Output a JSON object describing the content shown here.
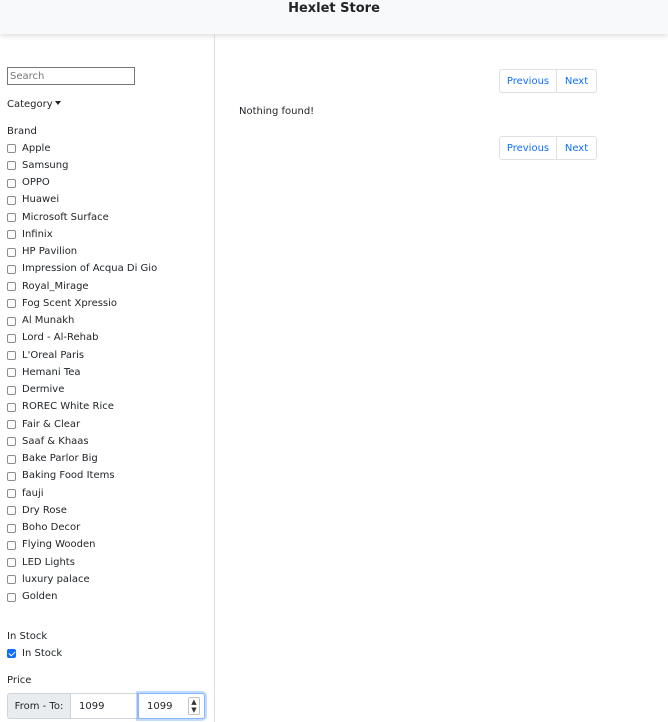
{
  "header": {
    "title": "Hexlet Store"
  },
  "sidebar": {
    "search": {
      "placeholder": "Search",
      "value": ""
    },
    "category_label": "Category",
    "brand_title": "Brand",
    "brands": [
      "Apple",
      "Samsung",
      "OPPO",
      "Huawei",
      "Microsoft Surface",
      "Infinix",
      "HP Pavilion",
      "Impression of Acqua Di Gio",
      "Royal_Mirage",
      "Fog Scent Xpressio",
      "Al Munakh",
      "Lord - Al-Rehab",
      "L'Oreal Paris",
      "Hemani Tea",
      "Dermive",
      "ROREC White Rice",
      "Fair & Clear",
      "Saaf & Khaas",
      "Bake Parlor Big",
      "Baking Food Items",
      "fauji",
      "Dry Rose",
      "Boho Decor",
      "Flying Wooden",
      "LED Lights",
      "luxury palace",
      "Golden"
    ],
    "stock_title": "In Stock",
    "stock_option": {
      "label": "In Stock",
      "checked": true
    },
    "price_title": "Price",
    "price": {
      "prefix": "From - To:",
      "from": "1099",
      "to": "1099"
    }
  },
  "main": {
    "pagination": {
      "previous": "Previous",
      "next": "Next"
    },
    "empty_message": "Nothing found!"
  },
  "colors": {
    "accent": "#0d6efd",
    "border": "#dee2e6",
    "header_bg": "#f8f9fa"
  }
}
